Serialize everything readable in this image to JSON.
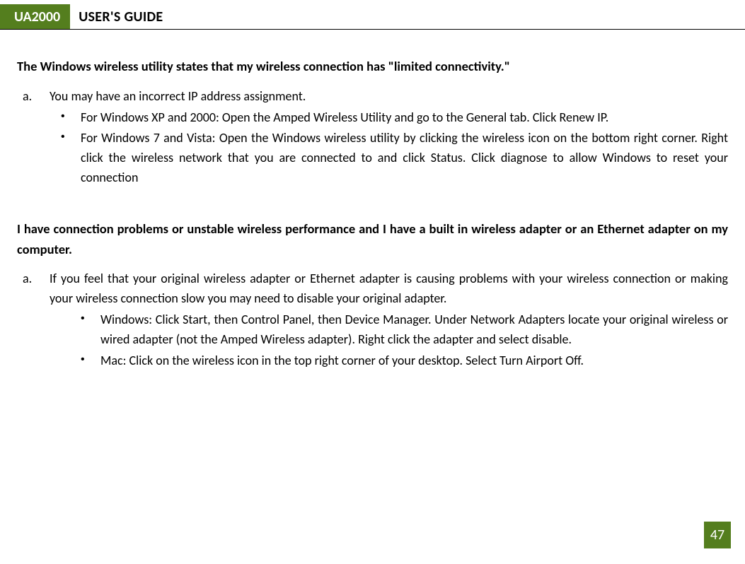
{
  "header": {
    "badge": "UA2000",
    "title": "USER'S GUIDE"
  },
  "s1": {
    "heading": "The Windows wireless utility states that my wireless connection has \"limited connectivity.\"",
    "a": "You may have an incorrect IP address assignment.",
    "b1": "For Windows XP and 2000: Open the Amped Wireless Utility and go to the General tab. Click Renew IP.",
    "b2": "For Windows 7 and Vista: Open the Windows wireless utility by clicking the wireless icon on the bottom right corner. Right click the wireless network that you are connected to and click Status. Click diagnose to allow Windows to reset your connection"
  },
  "s2": {
    "heading": "I have connection problems or unstable wireless performance and I have a built in wireless adapter or an Ethernet adapter on my computer.",
    "a": "If you feel that your original wireless adapter or Ethernet adapter is causing problems with your wireless connection or making your wireless connection slow you may need to disable your original adapter.",
    "b1": "Windows: Click Start, then Control Panel, then Device Manager. Under Network Adapters locate your original wireless or wired adapter (not the Amped Wireless adapter). Right click the adapter and select disable.",
    "b2": "Mac: Click on the wireless icon in the top right corner of your desktop. Select Turn Airport Off."
  },
  "page_number": "47"
}
